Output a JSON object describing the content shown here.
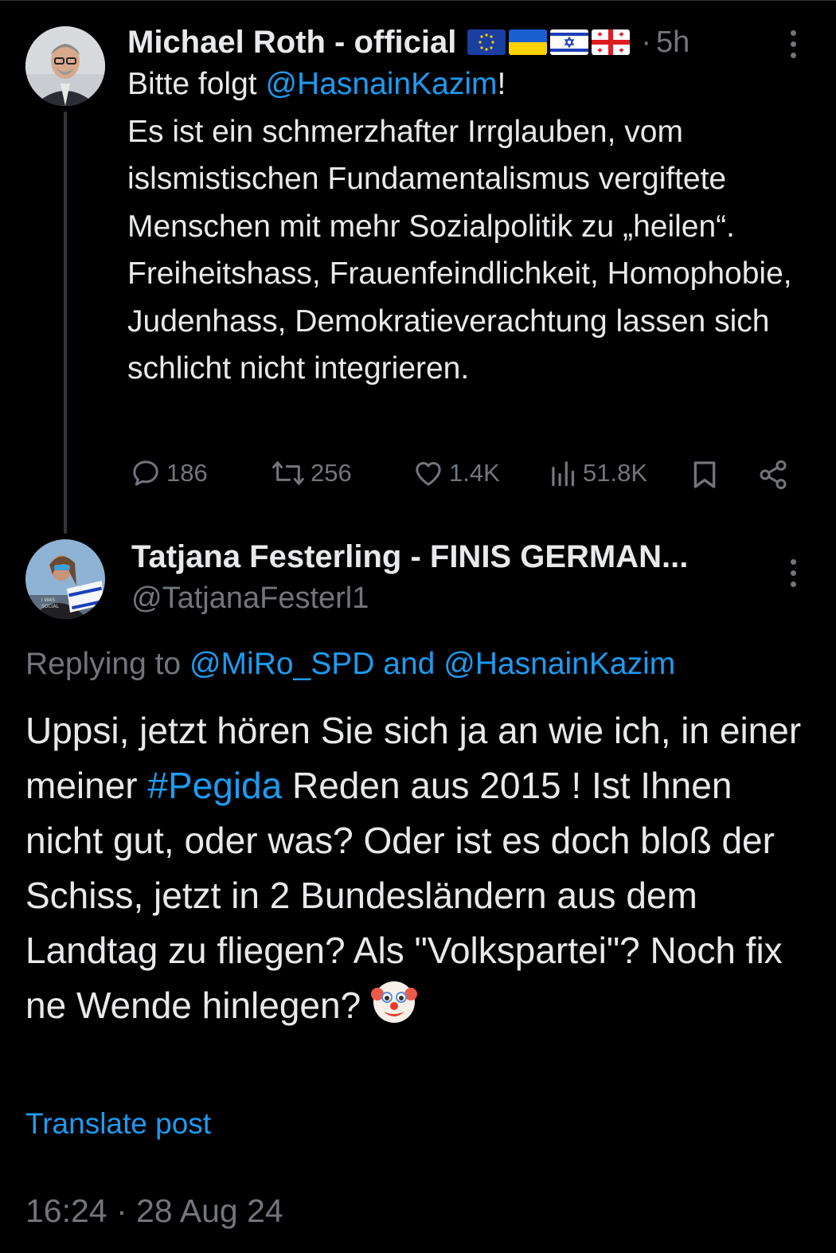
{
  "post1": {
    "author": "Michael Roth - official",
    "flags": [
      "eu-flag",
      "ukraine-flag",
      "israel-flag",
      "georgia-flag"
    ],
    "separator": "·",
    "time": "5h",
    "text_intro": "Bitte folgt ",
    "mention": "@HasnainKazim",
    "text_after_mention": "!",
    "body": "Es ist ein schmerzhafter Irrglauben, vom islsmistischen Fundamentalismus vergiftete Menschen mit mehr Sozialpolitik zu „heilen“.  Freiheitshass, Frauenfeindlichkeit, Homophobie, Judenhass, Demokratieverachtung lassen sich schlicht nicht integrieren.",
    "stats": {
      "replies": "186",
      "reposts": "256",
      "likes": "1.4K",
      "views": "51.8K"
    }
  },
  "post2": {
    "author": "Tatjana Festerling - FINIS GERMAN...",
    "handle": "@TatjanaFesterl1",
    "replying_label": "Replying to ",
    "reply_mention_1": "@MiRo_SPD",
    "reply_and": " and ",
    "reply_mention_2": "@HasnainKazim",
    "text_part1": "Uppsi, jetzt hören Sie sich ja an wie ich, in einer meiner ",
    "hashtag": "#Pegida",
    "text_part2": " Reden aus 2015 ! Ist Ihnen nicht gut, oder was? Oder ist es doch bloß der Schiss, jetzt in 2 Bundesländern aus dem Landtag zu fliegen? Als \"Volkspartei\"? Noch fix ne Wende hinlegen? ",
    "emoji": "🤡",
    "translate": "Translate post",
    "timestamp": "16:24 · 28 Aug 24"
  },
  "colors": {
    "background": "#000000",
    "text": "#e7e9ea",
    "muted": "#71767b",
    "link": "#1d9bf0"
  }
}
